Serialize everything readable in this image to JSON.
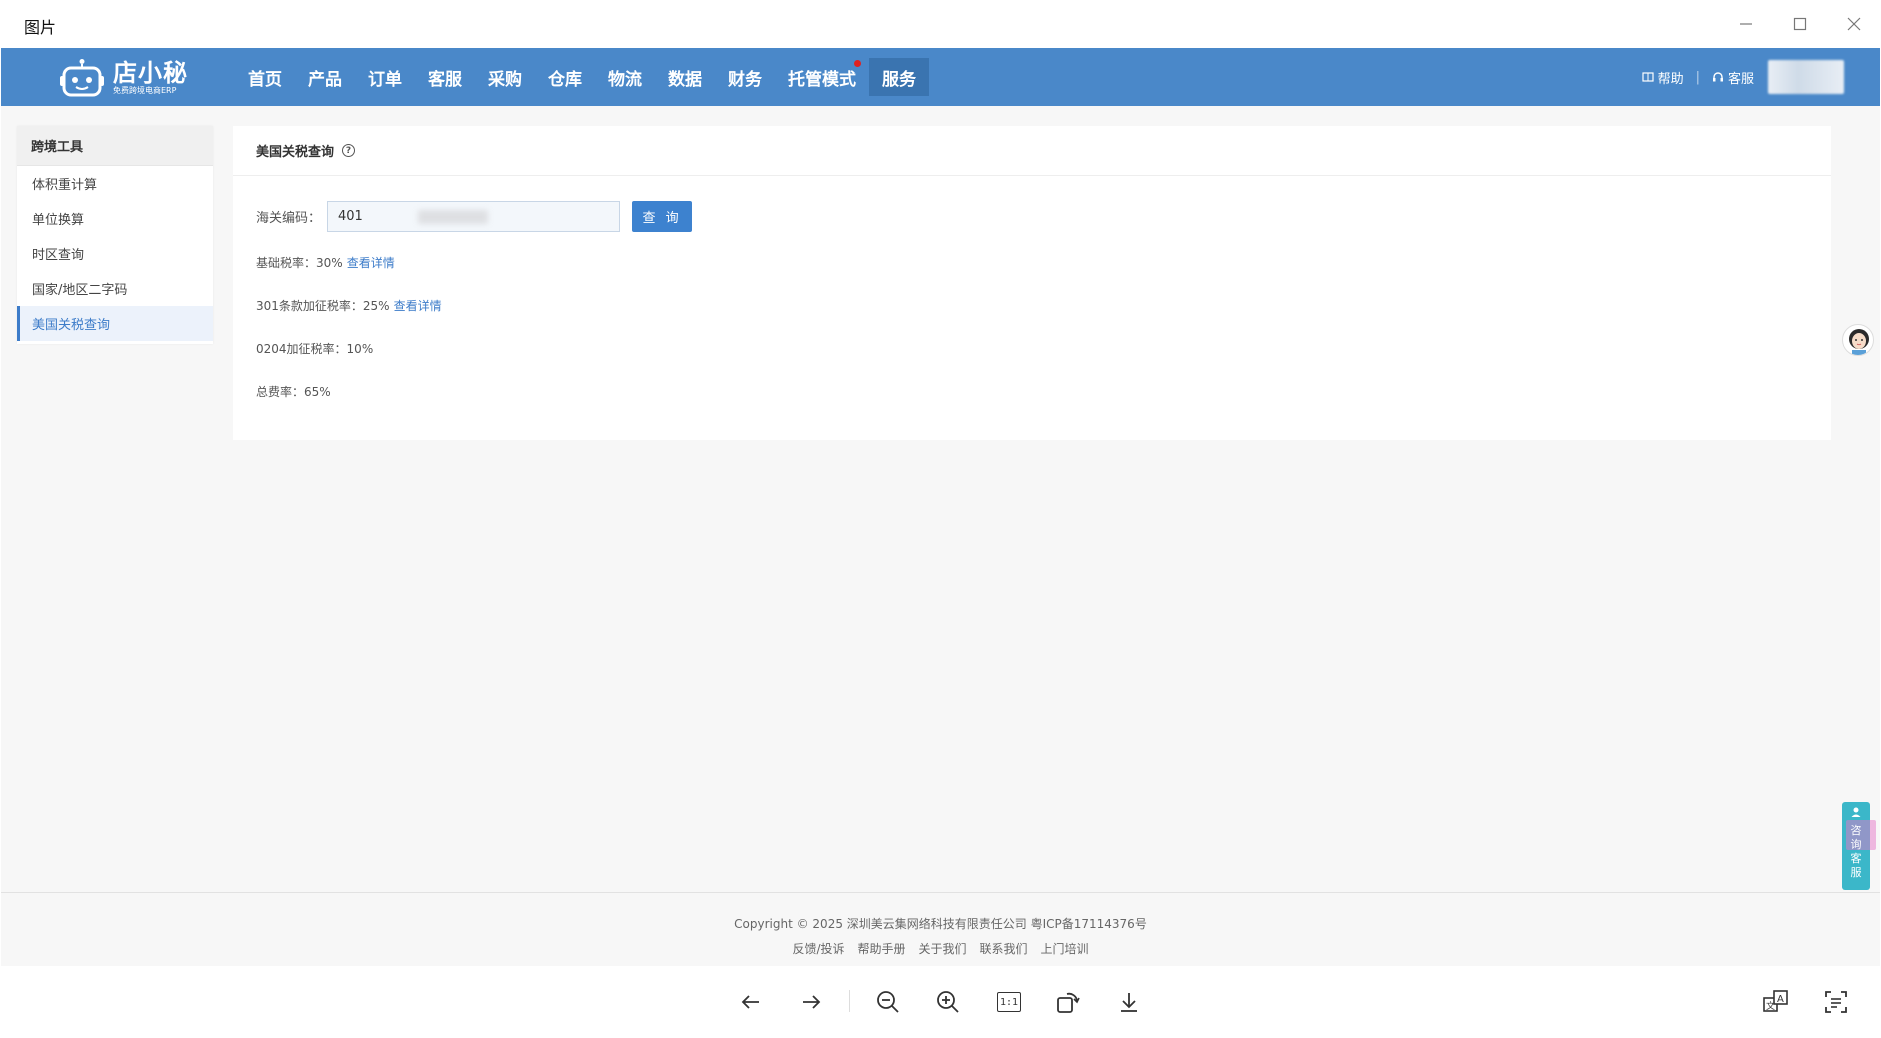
{
  "window": {
    "title": "图片"
  },
  "nav": {
    "logo_name": "店小秘",
    "logo_sub": "免费跨境电商ERP",
    "items": [
      {
        "label": "首页"
      },
      {
        "label": "产品"
      },
      {
        "label": "订单"
      },
      {
        "label": "客服"
      },
      {
        "label": "采购"
      },
      {
        "label": "仓库"
      },
      {
        "label": "物流"
      },
      {
        "label": "数据"
      },
      {
        "label": "财务"
      },
      {
        "label": "托管模式"
      },
      {
        "label": "服务"
      }
    ],
    "active_item": "服务",
    "help_label": "帮助",
    "service_label": "客服",
    "accent_color": "#4a88c9"
  },
  "sidebar": {
    "header": "跨境工具",
    "items": [
      {
        "label": "体积重计算"
      },
      {
        "label": "单位换算"
      },
      {
        "label": "时区查询"
      },
      {
        "label": "国家/地区二字码"
      },
      {
        "label": "美国关税查询"
      }
    ],
    "active_item": "美国关税查询"
  },
  "main": {
    "title": "美国关税查询",
    "form": {
      "label": "海关编码：",
      "value": "401",
      "query_button": "查 询"
    },
    "results": [
      {
        "label": "基础税率：",
        "value": "30%",
        "link": "查看详情"
      },
      {
        "label": "301条款加征税率：",
        "value": "25%",
        "link": "查看详情"
      },
      {
        "label": "0204加征税率：",
        "value": "10%",
        "link": ""
      },
      {
        "label": "总费率：",
        "value": "65%",
        "link": ""
      }
    ]
  },
  "widgets": {
    "cs_text": "咨询客服"
  },
  "footer": {
    "copyright": "Copyright © 2025 深圳美云集网络科技有限责任公司  粤ICP备17114376号",
    "links": [
      {
        "label": "反馈/投诉"
      },
      {
        "label": "帮助手册"
      },
      {
        "label": "关于我们"
      },
      {
        "label": "联系我们"
      },
      {
        "label": "上门培训"
      }
    ]
  },
  "viewer_toolbar": {
    "actual_size_label": "1:1"
  }
}
